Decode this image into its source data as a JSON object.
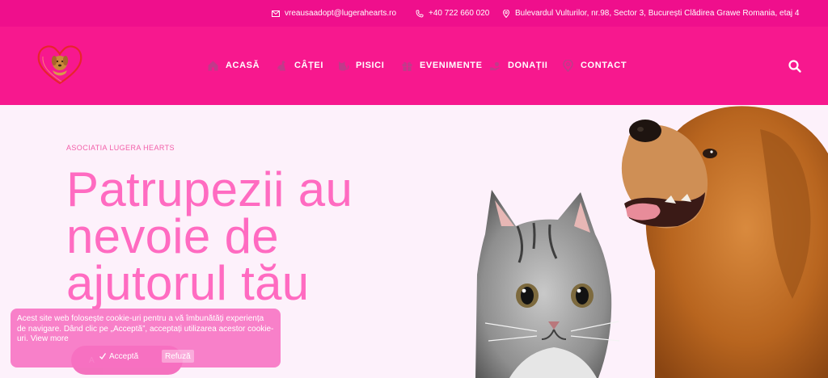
{
  "topbar": {
    "email": "vreausaadopt@lugerahearts.ro",
    "phone": "+40 722 660 020",
    "address": "Bulevardul Vulturilor, nr.98, Sector 3, București Clădirea Grawe Romania, etaj 4"
  },
  "nav": {
    "items": [
      {
        "label": "ACASĂ",
        "icon": "house-icon"
      },
      {
        "label": "CÂȚEI",
        "icon": "dog-icon"
      },
      {
        "label": "PISICI",
        "icon": "cat-icon"
      },
      {
        "label": "EVENIMENTE",
        "icon": "gift-icon"
      },
      {
        "label": "DONAȚII",
        "icon": "donate-icon"
      },
      {
        "label": "CONTACT",
        "icon": "location-pin-icon"
      }
    ]
  },
  "hero": {
    "eyebrow": "ASOCIATIA LUGERA HEARTS",
    "headline": "Patrupezii au nevoie de ajutorul tău",
    "cta_label": "A"
  },
  "cookie": {
    "message": "Acest site web folosește cookie-uri pentru a vă îmbunătăți experiența de navigare. Dând clic pe „Acceptă”, acceptați utilizarea acestor cookie-uri.",
    "view_more": "View more",
    "accept_label": "Acceptă",
    "refuse_label": "Refuză"
  },
  "colors": {
    "topbar": "#ef0f8c",
    "header": "#f7188e",
    "hero_bg": "#fdf1fb",
    "headline": "#ff6bc1",
    "cookie_bg": "#f76fc2"
  }
}
